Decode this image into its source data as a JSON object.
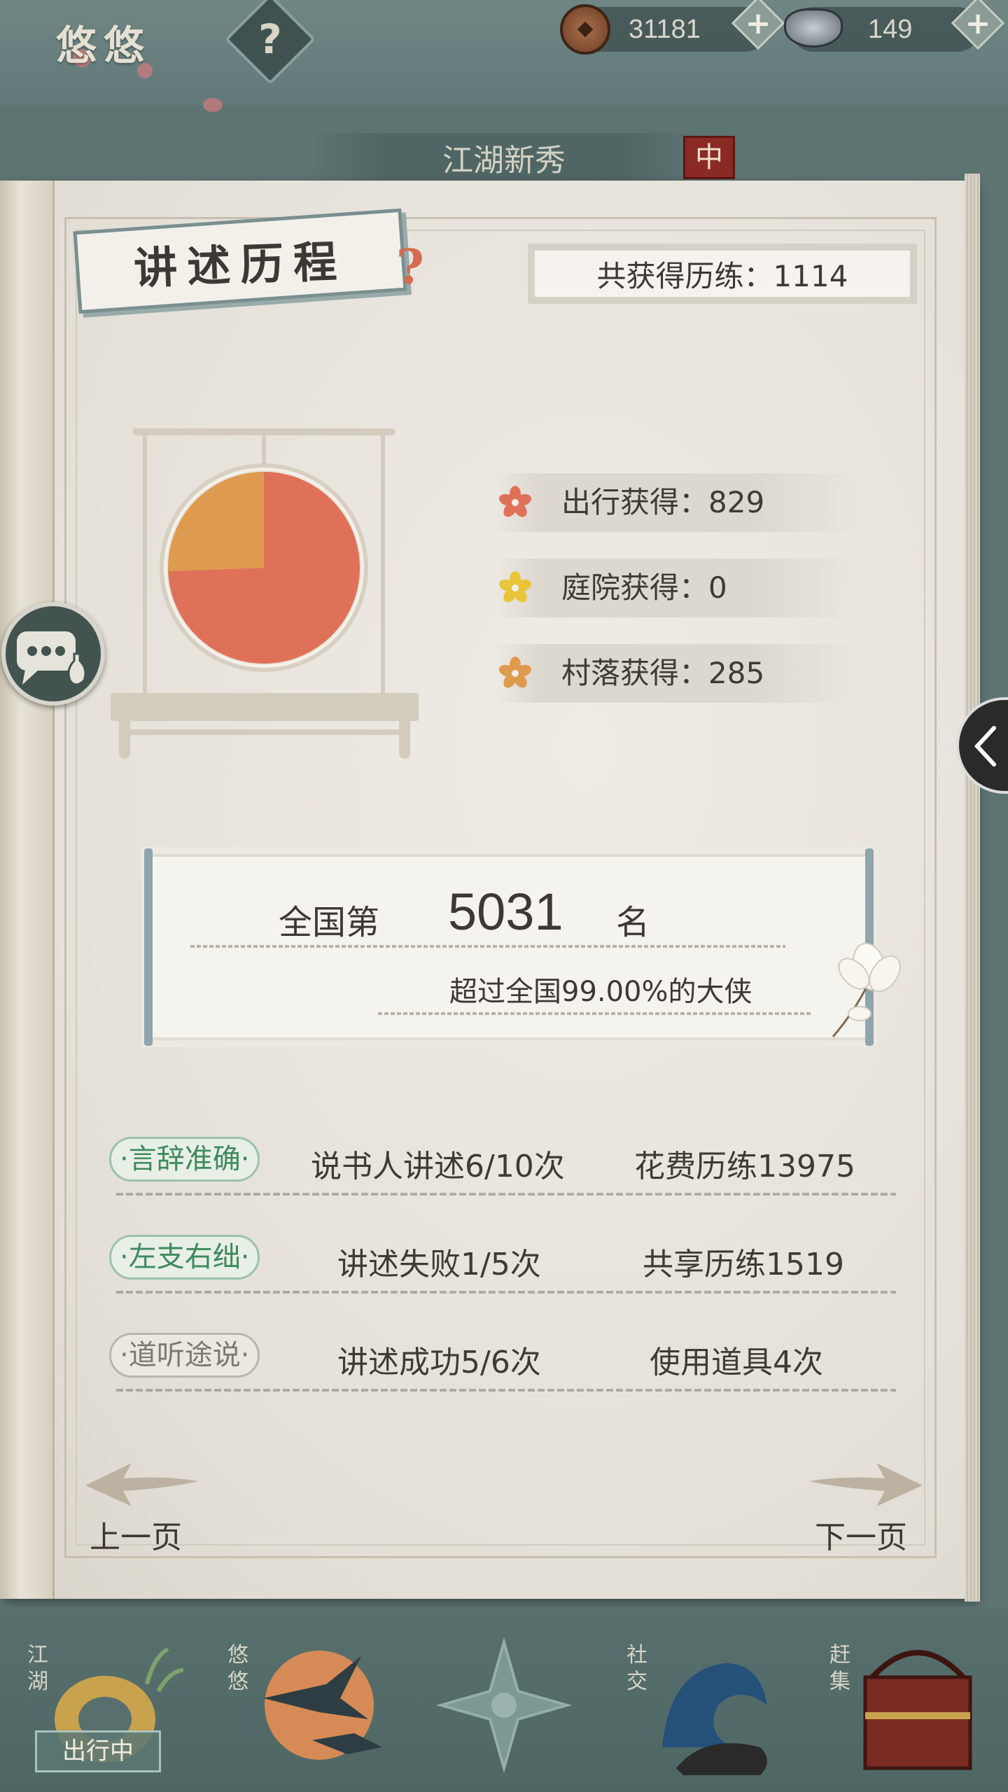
{
  "header": {
    "player_name": "悠悠",
    "help_glyph": "?",
    "currencies": [
      {
        "name": "coin",
        "icon": "copper-coin-icon",
        "value": "31181"
      },
      {
        "name": "ingot",
        "icon": "silver-ingot-icon",
        "value": "149"
      }
    ],
    "plus_glyph": "+",
    "title": "江湖新秀",
    "rank_badge": "中"
  },
  "book": {
    "section_title": "讲述历程",
    "section_help": "?",
    "total": "共获得历练：1114",
    "legend": [
      {
        "label": "出行获得：829",
        "color": "#e07159",
        "icon": "red-flower-icon"
      },
      {
        "label": "庭院获得：0",
        "color": "#e9c53c",
        "icon": "yellow-flower-icon"
      },
      {
        "label": "村落获得：285",
        "color": "#de9b4f",
        "icon": "orange-flower-icon"
      }
    ],
    "pie_values": [
      829,
      0,
      285
    ],
    "rank": {
      "prefix": "全国第",
      "number": "5031",
      "suffix": "名",
      "desc": "超过全国99.00%的大侠"
    },
    "stats": [
      {
        "tag": "·言辞准确·",
        "active": true,
        "c1": "说书人讲述6/10次",
        "c2": "花费历练13975"
      },
      {
        "tag": "·左支右绌·",
        "active": true,
        "c1": "讲述失败1/5次",
        "c2": "共享历练1519"
      },
      {
        "tag": "·道听途说·",
        "active": false,
        "c1": "讲述成功5/6次",
        "c2": "使用道具4次"
      }
    ],
    "prev_page": "上一页",
    "next_page": "下一页"
  },
  "bottom_nav": [
    {
      "label": "江湖",
      "badge": "出行中",
      "icon": "jianghu-icon"
    },
    {
      "label": "悠悠",
      "icon": "youyou-swallow-icon"
    },
    {
      "label": "",
      "icon": "compass-star-icon"
    },
    {
      "label": "社交",
      "icon": "social-wave-icon"
    },
    {
      "label": "赶集",
      "icon": "market-basket-icon"
    }
  ]
}
